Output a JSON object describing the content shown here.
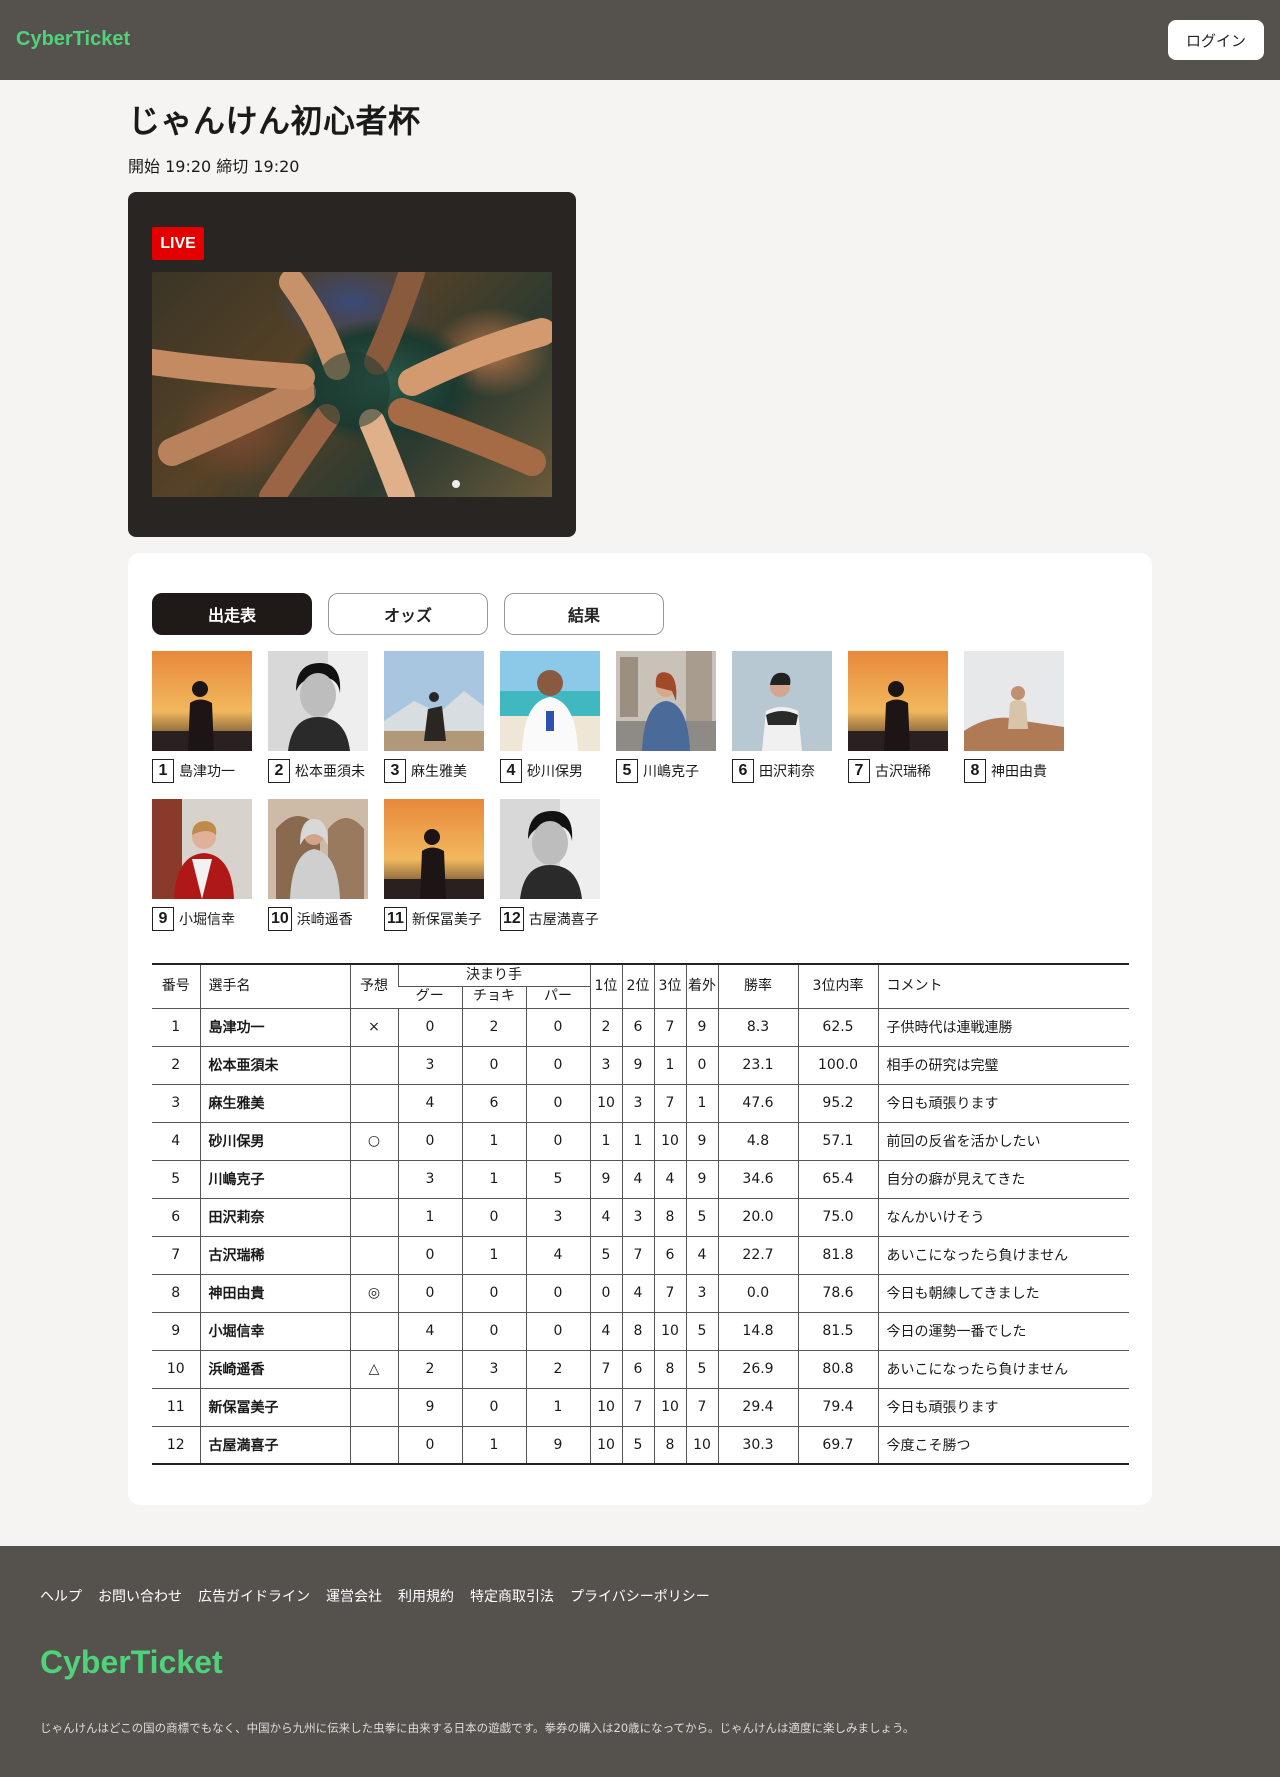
{
  "header": {
    "brand": "CyberTicket",
    "login_label": "ログイン"
  },
  "event": {
    "title": "じゃんけん初心者杯",
    "schedule": "開始 19:20 締切 19:20",
    "live_label": "LIVE"
  },
  "tabs": [
    {
      "label": "出走表",
      "active": true
    },
    {
      "label": "オッズ",
      "active": false
    },
    {
      "label": "結果",
      "active": false
    }
  ],
  "players": [
    {
      "no": "1",
      "name": "島津功一",
      "photo": "sunset-silhouette"
    },
    {
      "no": "2",
      "name": "松本亜須未",
      "photo": "bw-portrait"
    },
    {
      "no": "3",
      "name": "麻生雅美",
      "photo": "horse-rider"
    },
    {
      "no": "4",
      "name": "砂川保男",
      "photo": "karate-beach"
    },
    {
      "no": "5",
      "name": "川嶋克子",
      "photo": "city-woman"
    },
    {
      "no": "6",
      "name": "田沢莉奈",
      "photo": "wall-woman"
    },
    {
      "no": "7",
      "name": "古沢瑞稀",
      "photo": "sunset-silhouette"
    },
    {
      "no": "8",
      "name": "神田由貴",
      "photo": "rock-sitter"
    },
    {
      "no": "9",
      "name": "小堀信幸",
      "photo": "brick-jacket"
    },
    {
      "no": "10",
      "name": "浜崎遥香",
      "photo": "hood-woman"
    },
    {
      "no": "11",
      "name": "新保冨美子",
      "photo": "sunset-silhouette"
    },
    {
      "no": "12",
      "name": "古屋満喜子",
      "photo": "bw-portrait"
    }
  ],
  "table": {
    "headers": {
      "no": "番号",
      "name": "選手名",
      "pick": "予想",
      "moves": "決まり手",
      "gu": "グー",
      "choki": "チョキ",
      "pa": "パー",
      "p1": "1位",
      "p2": "2位",
      "p3": "3位",
      "out": "着外",
      "win_rate": "勝率",
      "top3_rate": "3位内率",
      "comment": "コメント"
    },
    "rows": [
      {
        "no": "1",
        "name": "島津功一",
        "pick": "×",
        "gu": "0",
        "choki": "2",
        "pa": "0",
        "p1": "2",
        "p2": "6",
        "p3": "7",
        "out": "9",
        "win": "8.3",
        "top3": "62.5",
        "comment": "子供時代は連戦連勝"
      },
      {
        "no": "2",
        "name": "松本亜須未",
        "pick": "",
        "gu": "3",
        "choki": "0",
        "pa": "0",
        "p1": "3",
        "p2": "9",
        "p3": "1",
        "out": "0",
        "win": "23.1",
        "top3": "100.0",
        "comment": "相手の研究は完璧"
      },
      {
        "no": "3",
        "name": "麻生雅美",
        "pick": "",
        "gu": "4",
        "choki": "6",
        "pa": "0",
        "p1": "10",
        "p2": "3",
        "p3": "7",
        "out": "1",
        "win": "47.6",
        "top3": "95.2",
        "comment": "今日も頑張ります"
      },
      {
        "no": "4",
        "name": "砂川保男",
        "pick": "○",
        "gu": "0",
        "choki": "1",
        "pa": "0",
        "p1": "1",
        "p2": "1",
        "p3": "10",
        "out": "9",
        "win": "4.8",
        "top3": "57.1",
        "comment": "前回の反省を活かしたい"
      },
      {
        "no": "5",
        "name": "川嶋克子",
        "pick": "",
        "gu": "3",
        "choki": "1",
        "pa": "5",
        "p1": "9",
        "p2": "4",
        "p3": "4",
        "out": "9",
        "win": "34.6",
        "top3": "65.4",
        "comment": "自分の癖が見えてきた"
      },
      {
        "no": "6",
        "name": "田沢莉奈",
        "pick": "",
        "gu": "1",
        "choki": "0",
        "pa": "3",
        "p1": "4",
        "p2": "3",
        "p3": "8",
        "out": "5",
        "win": "20.0",
        "top3": "75.0",
        "comment": "なんかいけそう"
      },
      {
        "no": "7",
        "name": "古沢瑞稀",
        "pick": "",
        "gu": "0",
        "choki": "1",
        "pa": "4",
        "p1": "5",
        "p2": "7",
        "p3": "6",
        "out": "4",
        "win": "22.7",
        "top3": "81.8",
        "comment": "あいこになったら負けません"
      },
      {
        "no": "8",
        "name": "神田由貴",
        "pick": "◎",
        "gu": "0",
        "choki": "0",
        "pa": "0",
        "p1": "0",
        "p2": "4",
        "p3": "7",
        "out": "3",
        "win": "0.0",
        "top3": "78.6",
        "comment": "今日も朝練してきました"
      },
      {
        "no": "9",
        "name": "小堀信幸",
        "pick": "",
        "gu": "4",
        "choki": "0",
        "pa": "0",
        "p1": "4",
        "p2": "8",
        "p3": "10",
        "out": "5",
        "win": "14.8",
        "top3": "81.5",
        "comment": "今日の運勢一番でした"
      },
      {
        "no": "10",
        "name": "浜崎遥香",
        "pick": "△",
        "gu": "2",
        "choki": "3",
        "pa": "2",
        "p1": "7",
        "p2": "6",
        "p3": "8",
        "out": "5",
        "win": "26.9",
        "top3": "80.8",
        "comment": "あいこになったら負けません"
      },
      {
        "no": "11",
        "name": "新保冨美子",
        "pick": "",
        "gu": "9",
        "choki": "0",
        "pa": "1",
        "p1": "10",
        "p2": "7",
        "p3": "10",
        "out": "7",
        "win": "29.4",
        "top3": "79.4",
        "comment": "今日も頑張ります"
      },
      {
        "no": "12",
        "name": "古屋満喜子",
        "pick": "",
        "gu": "0",
        "choki": "1",
        "pa": "9",
        "p1": "10",
        "p2": "5",
        "p3": "8",
        "out": "10",
        "win": "30.3",
        "top3": "69.7",
        "comment": "今度こそ勝つ"
      }
    ]
  },
  "footer": {
    "links": [
      "ヘルプ",
      "お問い合わせ",
      "広告ガイドライン",
      "運営会社",
      "利用規約",
      "特定商取引法",
      "プライバシーポリシー"
    ],
    "brand": "CyberTicket",
    "note": "じゃんけんはどこの国の商標でもなく、中国から九州に伝来した虫拳に由来する日本の遊戯です。拳券の購入は20歳になってから。じゃんけんは適度に楽しみましょう。"
  },
  "colors": {
    "brand_green": "#4ed27a",
    "header_bg": "#55524e",
    "live_red": "#e50000",
    "tab_active": "#1f1a17"
  }
}
